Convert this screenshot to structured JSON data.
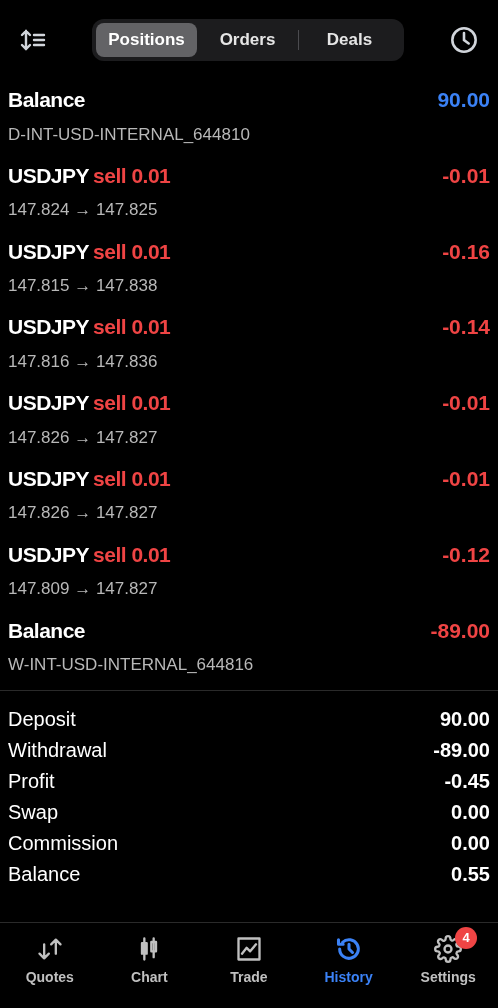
{
  "tabs": [
    {
      "label": "Positions",
      "selected": true
    },
    {
      "label": "Orders",
      "selected": false
    },
    {
      "label": "Deals",
      "selected": false
    }
  ],
  "rows": [
    {
      "kind": "deposit",
      "title": "Balance",
      "detail": "D-INT-USD-INTERNAL_644810",
      "value": "90.00"
    },
    {
      "kind": "trade",
      "title": "USDJPY",
      "side": "sell",
      "volume": "0.01",
      "detail": "147.824 → 147.825",
      "value": "-0.01"
    },
    {
      "kind": "trade",
      "title": "USDJPY",
      "side": "sell",
      "volume": "0.01",
      "detail": "147.815 → 147.838",
      "value": "-0.16"
    },
    {
      "kind": "trade",
      "title": "USDJPY",
      "side": "sell",
      "volume": "0.01",
      "detail": "147.816 → 147.836",
      "value": "-0.14"
    },
    {
      "kind": "trade",
      "title": "USDJPY",
      "side": "sell",
      "volume": "0.01",
      "detail": "147.826 → 147.827",
      "value": "-0.01"
    },
    {
      "kind": "trade",
      "title": "USDJPY",
      "side": "sell",
      "volume": "0.01",
      "detail": "147.826 → 147.827",
      "value": "-0.01"
    },
    {
      "kind": "trade",
      "title": "USDJPY",
      "side": "sell",
      "volume": "0.01",
      "detail": "147.809 → 147.827",
      "value": "-0.12"
    },
    {
      "kind": "withdrawal",
      "title": "Balance",
      "detail": "W-INT-USD-INTERNAL_644816",
      "value": "-89.00"
    }
  ],
  "summary": [
    {
      "label": "Deposit",
      "value": "90.00"
    },
    {
      "label": "Withdrawal",
      "value": "-89.00"
    },
    {
      "label": "Profit",
      "value": "-0.45"
    },
    {
      "label": "Swap",
      "value": "0.00"
    },
    {
      "label": "Commission",
      "value": "0.00"
    },
    {
      "label": "Balance",
      "value": "0.55"
    }
  ],
  "nav": [
    {
      "kind": "quotes",
      "label": "Quotes",
      "selected": false
    },
    {
      "kind": "chart",
      "label": "Chart",
      "selected": false
    },
    {
      "kind": "trade",
      "label": "Trade",
      "selected": false
    },
    {
      "kind": "history",
      "label": "History",
      "selected": true
    },
    {
      "kind": "settings",
      "label": "Settings",
      "selected": false,
      "badge": "4"
    }
  ]
}
